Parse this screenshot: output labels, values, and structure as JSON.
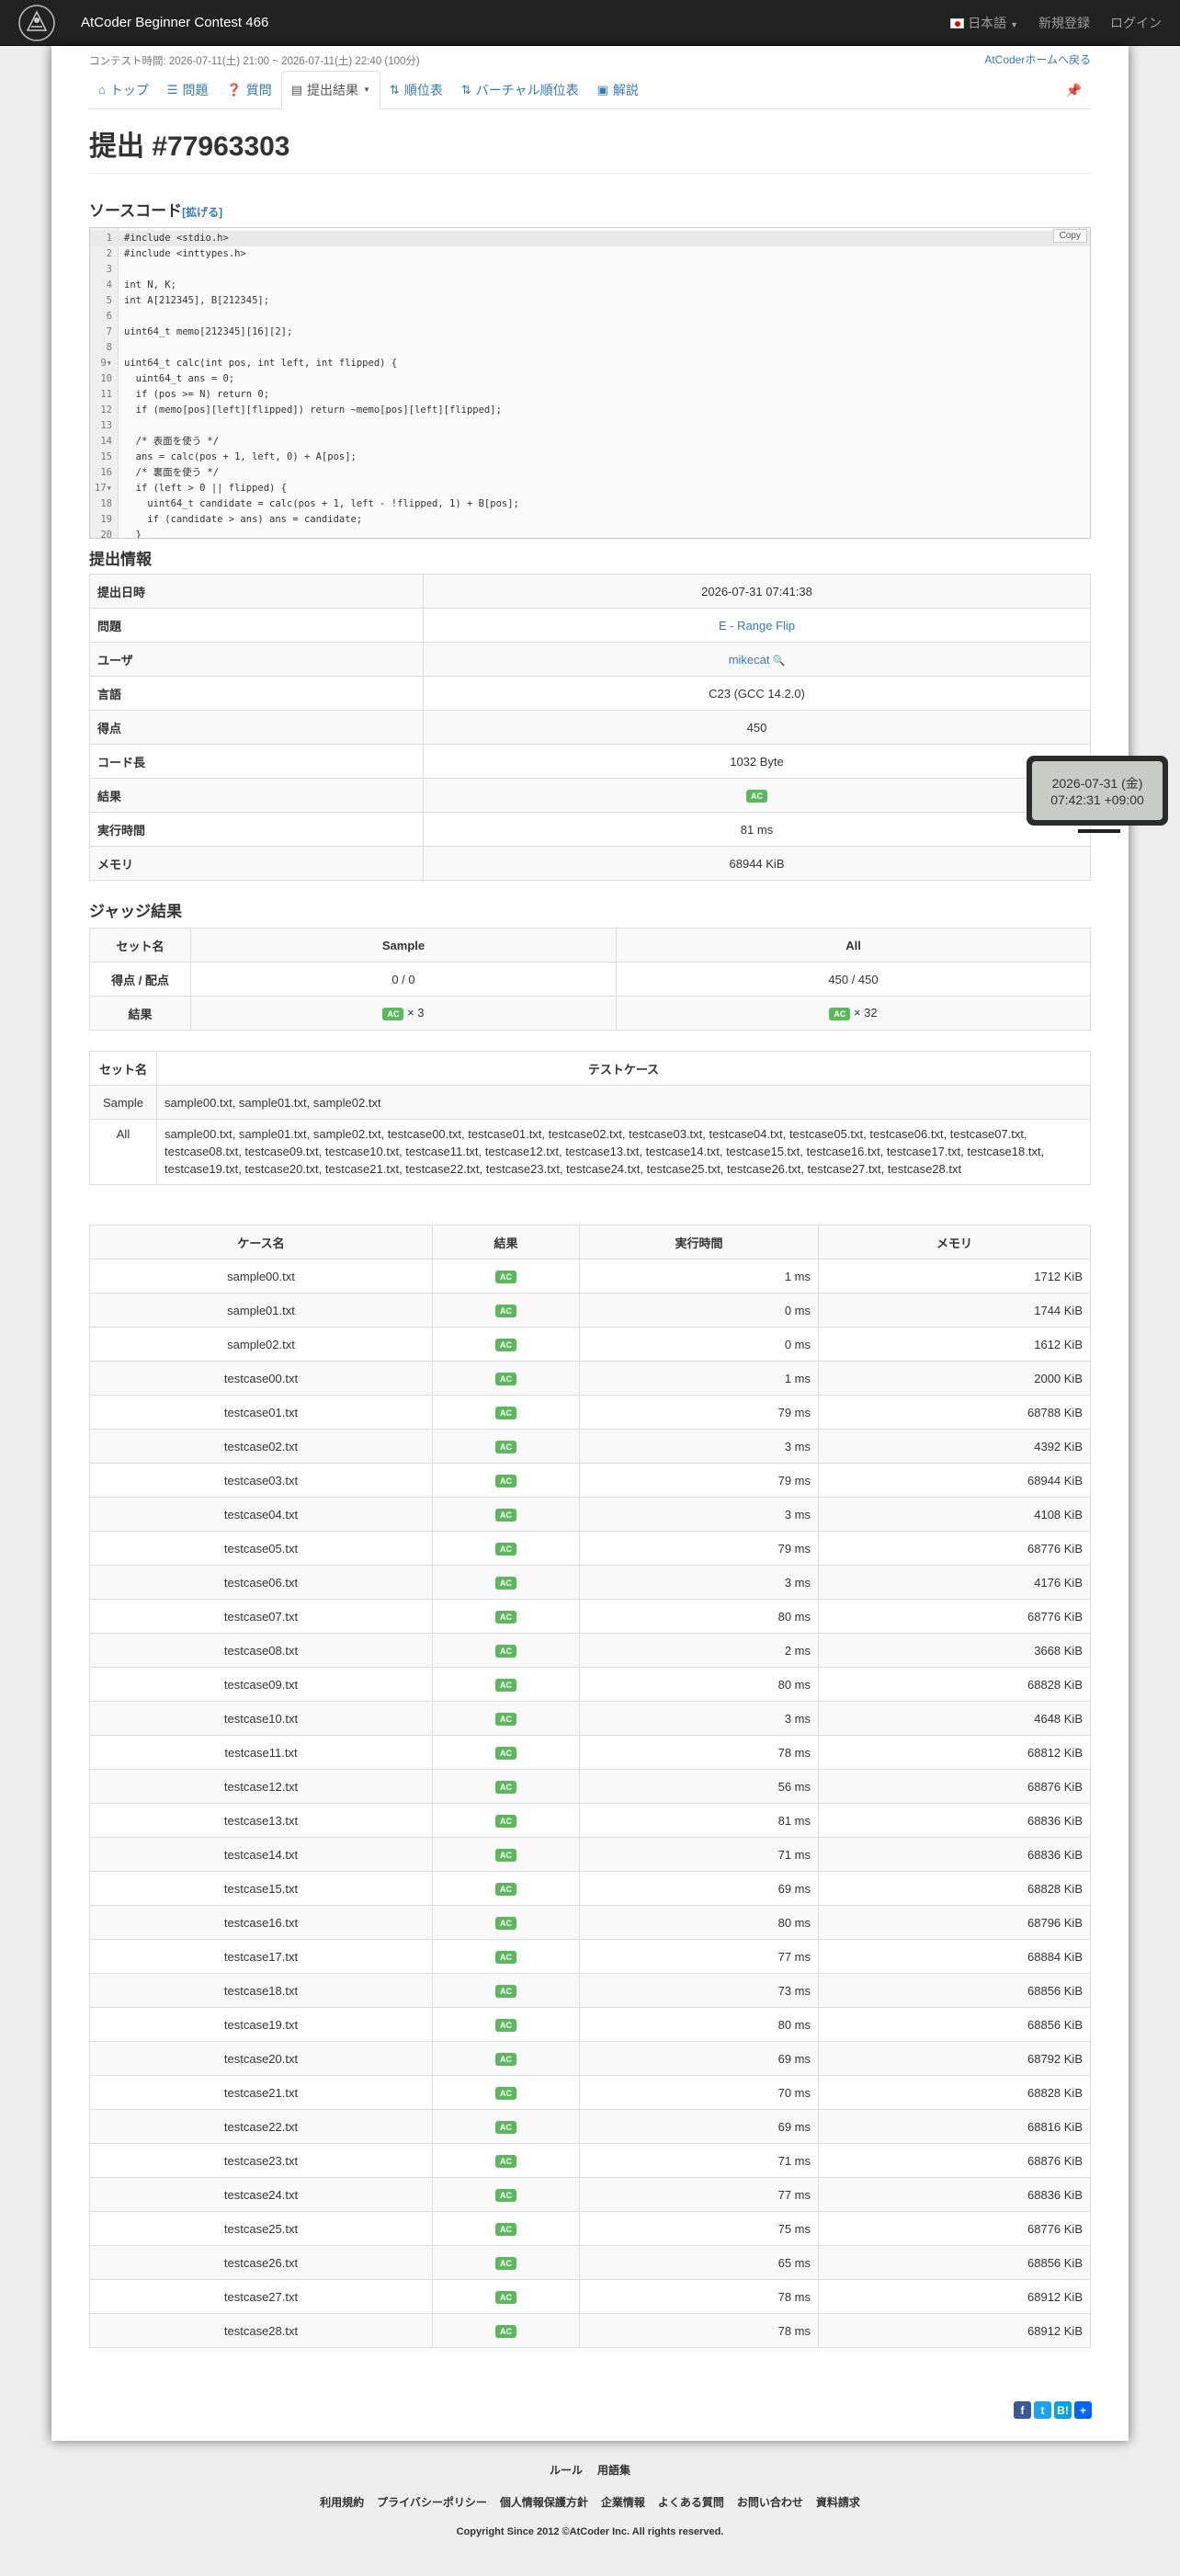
{
  "navbar": {
    "brand": "AtCoder Beginner Contest 466",
    "language": "日本語",
    "signup": "新規登録",
    "login": "ログイン"
  },
  "contest_time": "コンテスト時間: 2026-07-11(土) 21:00 ~ 2026-07-11(土) 22:40 (100分)",
  "home_link": "AtCoderホームへ戻る",
  "tabs": [
    {
      "icon": "home-icon",
      "label": "トップ"
    },
    {
      "icon": "list-icon",
      "label": "問題"
    },
    {
      "icon": "question-icon",
      "label": "質問"
    },
    {
      "icon": "table-icon",
      "label": "提出結果"
    },
    {
      "icon": "sort-icon",
      "label": "順位表"
    },
    {
      "icon": "sort-icon",
      "label": "バーチャル順位表"
    },
    {
      "icon": "book-icon",
      "label": "解説"
    }
  ],
  "title": "提出 #77963303",
  "source": {
    "heading": "ソースコード",
    "expand": "[拡げる]",
    "copy": "Copy",
    "lines": [
      "#include <stdio.h>",
      "#include <inttypes.h>",
      "",
      "int N, K;",
      "int A[212345], B[212345];",
      "",
      "uint64_t memo[212345][16][2];",
      "",
      "uint64_t calc(int pos, int left, int flipped) {",
      "  uint64_t ans = 0;",
      "  if (pos >= N) return 0;",
      "  if (memo[pos][left][flipped]) return ~memo[pos][left][flipped];",
      "",
      "  /* 表面を使う */",
      "  ans = calc(pos + 1, left, 0) + A[pos];",
      "  /* 裏面を使う */",
      "  if (left > 0 || flipped) {",
      "    uint64_t candidate = calc(pos + 1, left - !flipped, 1) + B[pos];",
      "    if (candidate > ans) ans = candidate;",
      "  }"
    ],
    "fold_lines": [
      9,
      17
    ]
  },
  "submission_info": {
    "heading": "提出情報",
    "rows": [
      {
        "label": "提出日時",
        "value": "2026-07-31 07:41:38"
      },
      {
        "label": "問題",
        "value": "E - Range Flip",
        "link": true
      },
      {
        "label": "ユーザ",
        "value": "mikecat",
        "link": true,
        "search": true
      },
      {
        "label": "言語",
        "value": "C23 (GCC 14.2.0)"
      },
      {
        "label": "得点",
        "value": "450"
      },
      {
        "label": "コード長",
        "value": "1032 Byte"
      },
      {
        "label": "結果",
        "value": "AC",
        "badge": true
      },
      {
        "label": "実行時間",
        "value": "81 ms"
      },
      {
        "label": "メモリ",
        "value": "68944 KiB"
      }
    ]
  },
  "tooltip": {
    "line1": "2026-07-31 (金)",
    "line2": "07:42:31 +09:00"
  },
  "judge": {
    "heading": "ジャッジ結果",
    "summary_headers": [
      "セット名",
      "Sample",
      "All"
    ],
    "score_label": "得点 / 配点",
    "score_sample": "0 / 0",
    "score_all": "450 / 450",
    "result_label": "結果",
    "result_sample": "× 3",
    "result_all": "× 32",
    "sets_headers": [
      "セット名",
      "テストケース"
    ],
    "sets": [
      {
        "name": "Sample",
        "cases": "sample00.txt, sample01.txt, sample02.txt"
      },
      {
        "name": "All",
        "cases": "sample00.txt, sample01.txt, sample02.txt, testcase00.txt, testcase01.txt, testcase02.txt, testcase03.txt, testcase04.txt, testcase05.txt, testcase06.txt, testcase07.txt, testcase08.txt, testcase09.txt, testcase10.txt, testcase11.txt, testcase12.txt, testcase13.txt, testcase14.txt, testcase15.txt, testcase16.txt, testcase17.txt, testcase18.txt, testcase19.txt, testcase20.txt, testcase21.txt, testcase22.txt, testcase23.txt, testcase24.txt, testcase25.txt, testcase26.txt, testcase27.txt, testcase28.txt"
      }
    ],
    "case_headers": [
      "ケース名",
      "結果",
      "実行時間",
      "メモリ"
    ],
    "cases": [
      [
        "sample00.txt",
        "AC",
        "1 ms",
        "1712 KiB"
      ],
      [
        "sample01.txt",
        "AC",
        "0 ms",
        "1744 KiB"
      ],
      [
        "sample02.txt",
        "AC",
        "0 ms",
        "1612 KiB"
      ],
      [
        "testcase00.txt",
        "AC",
        "1 ms",
        "2000 KiB"
      ],
      [
        "testcase01.txt",
        "AC",
        "79 ms",
        "68788 KiB"
      ],
      [
        "testcase02.txt",
        "AC",
        "3 ms",
        "4392 KiB"
      ],
      [
        "testcase03.txt",
        "AC",
        "79 ms",
        "68944 KiB"
      ],
      [
        "testcase04.txt",
        "AC",
        "3 ms",
        "4108 KiB"
      ],
      [
        "testcase05.txt",
        "AC",
        "79 ms",
        "68776 KiB"
      ],
      [
        "testcase06.txt",
        "AC",
        "3 ms",
        "4176 KiB"
      ],
      [
        "testcase07.txt",
        "AC",
        "80 ms",
        "68776 KiB"
      ],
      [
        "testcase08.txt",
        "AC",
        "2 ms",
        "3668 KiB"
      ],
      [
        "testcase09.txt",
        "AC",
        "80 ms",
        "68828 KiB"
      ],
      [
        "testcase10.txt",
        "AC",
        "3 ms",
        "4648 KiB"
      ],
      [
        "testcase11.txt",
        "AC",
        "78 ms",
        "68812 KiB"
      ],
      [
        "testcase12.txt",
        "AC",
        "56 ms",
        "68876 KiB"
      ],
      [
        "testcase13.txt",
        "AC",
        "81 ms",
        "68836 KiB"
      ],
      [
        "testcase14.txt",
        "AC",
        "71 ms",
        "68836 KiB"
      ],
      [
        "testcase15.txt",
        "AC",
        "69 ms",
        "68828 KiB"
      ],
      [
        "testcase16.txt",
        "AC",
        "80 ms",
        "68796 KiB"
      ],
      [
        "testcase17.txt",
        "AC",
        "77 ms",
        "68884 KiB"
      ],
      [
        "testcase18.txt",
        "AC",
        "73 ms",
        "68856 KiB"
      ],
      [
        "testcase19.txt",
        "AC",
        "80 ms",
        "68856 KiB"
      ],
      [
        "testcase20.txt",
        "AC",
        "69 ms",
        "68792 KiB"
      ],
      [
        "testcase21.txt",
        "AC",
        "70 ms",
        "68828 KiB"
      ],
      [
        "testcase22.txt",
        "AC",
        "69 ms",
        "68816 KiB"
      ],
      [
        "testcase23.txt",
        "AC",
        "71 ms",
        "68876 KiB"
      ],
      [
        "testcase24.txt",
        "AC",
        "77 ms",
        "68836 KiB"
      ],
      [
        "testcase25.txt",
        "AC",
        "75 ms",
        "68776 KiB"
      ],
      [
        "testcase26.txt",
        "AC",
        "65 ms",
        "68856 KiB"
      ],
      [
        "testcase27.txt",
        "AC",
        "78 ms",
        "68912 KiB"
      ],
      [
        "testcase28.txt",
        "AC",
        "78 ms",
        "68912 KiB"
      ]
    ]
  },
  "share": [
    {
      "icon": "facebook-icon",
      "glyph": "f",
      "color": "#3b5998"
    },
    {
      "icon": "twitter-icon",
      "glyph": "t",
      "color": "#1da1f2"
    },
    {
      "icon": "hatena-icon",
      "glyph": "B!",
      "color": "#00a4de"
    },
    {
      "icon": "addtoany-icon",
      "glyph": "+",
      "color": "#0166ff"
    }
  ],
  "footer": {
    "row1": [
      "ルール",
      "用語集"
    ],
    "row2": [
      "利用規約",
      "プライバシーポリシー",
      "個人情報保護方針",
      "企業情報",
      "よくある質問",
      "お問い合わせ",
      "資料請求"
    ],
    "copyright": "Copyright Since 2012 ©AtCoder Inc. All rights reserved."
  },
  "colors": {
    "ac": "#5cb85c",
    "link": "#337ab7",
    "navbar": "#222222"
  }
}
